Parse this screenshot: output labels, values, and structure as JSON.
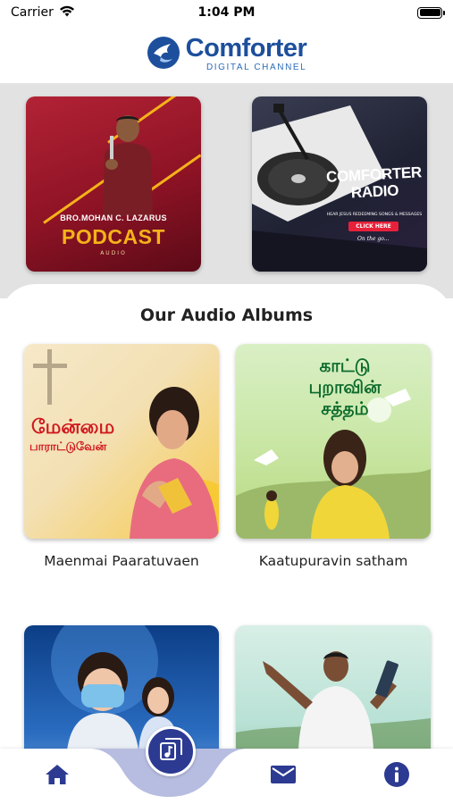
{
  "status_bar": {
    "carrier": "Carrier",
    "time": "1:04 PM"
  },
  "header": {
    "logo_title": "Comforter",
    "logo_subtitle": "DIGITAL CHANNEL"
  },
  "featured": {
    "podcast": {
      "speaker": "BRO.MOHAN C. LAZARUS",
      "title": "PODCAST",
      "subtitle": "AUDIO"
    },
    "radio": {
      "title_line1": "COMFORTER",
      "title_line2": "RADIO",
      "description": "HEAR JESUS REDEEMING SONGS & MESSAGES",
      "button": "CLICK HERE",
      "tagline": "On the go..."
    }
  },
  "albums": {
    "heading": "Our Audio Albums",
    "items": [
      {
        "title": "Maenmai Paaratuvaen",
        "art_text": "மேன்மை",
        "art_text2": "பாராட்டுவேன்"
      },
      {
        "title": "Kaatupuravin satham",
        "art_text": "காட்டு புறாவின் சத்தம்"
      },
      {
        "title": ""
      },
      {
        "title": ""
      }
    ]
  },
  "nav": {
    "items": [
      "home-icon",
      "music-library-icon",
      "mail-icon",
      "info-icon"
    ],
    "active": "music-library-icon"
  },
  "colors": {
    "brand": "#1d4f9c",
    "nav": "#2c3a92",
    "podcast_accent": "#f5b21a",
    "radio_button": "#e8213b"
  }
}
